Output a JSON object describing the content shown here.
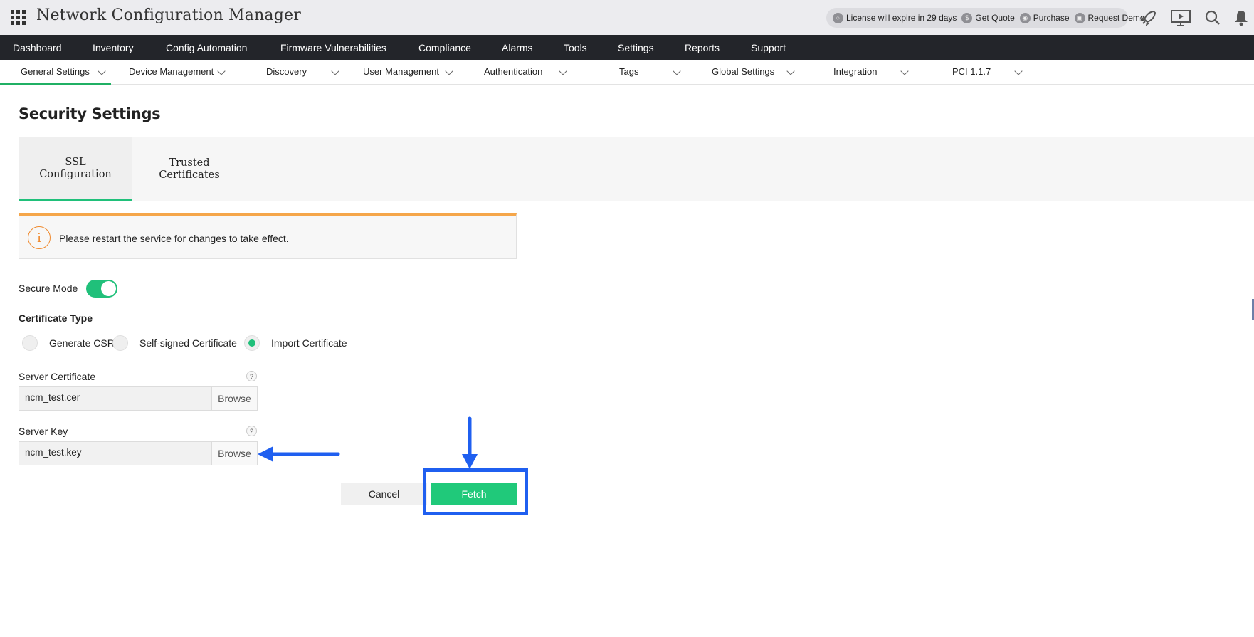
{
  "app": {
    "title": "Network Configuration Manager",
    "license_text": "License will expire in 29 days",
    "get_quote": "Get Quote",
    "purchase": "Purchase",
    "request_demo": "Request Demo"
  },
  "main_nav": [
    "Dashboard",
    "Inventory",
    "Config Automation",
    "Firmware Vulnerabilities",
    "Compliance",
    "Alarms",
    "Tools",
    "Settings",
    "Reports",
    "Support"
  ],
  "sub_nav": [
    "General Settings",
    "Device Management",
    "Discovery",
    "User Management",
    "Authentication",
    "Tags",
    "Global Settings",
    "Integration",
    "PCI 1.1.7"
  ],
  "page": {
    "title": "Security Settings",
    "tabs": [
      {
        "line1": "SSL",
        "line2": "Configuration",
        "active": true
      },
      {
        "line1": "Trusted",
        "line2": "Certificates",
        "active": false
      }
    ],
    "alert": "Please restart the service for changes to take effect.",
    "secure_mode_label": "Secure Mode",
    "secure_mode_on": true,
    "certificate_type_label": "Certificate Type",
    "certificate_options": [
      "Generate CSR",
      "Self-signed Certificate",
      "Import Certificate"
    ],
    "certificate_selected": "Import Certificate",
    "server_certificate_label": "Server Certificate",
    "server_certificate_value": "ncm_test.cer",
    "server_key_label": "Server Key",
    "server_key_value": "ncm_test.key",
    "browse_label": "Browse",
    "help_mark": "?",
    "cancel_label": "Cancel",
    "fetch_label": "Fetch"
  },
  "colors": {
    "accent_green": "#20c97a",
    "annotation_blue": "#1f5ff0",
    "alert_orange": "#f5a64a",
    "nav_bg": "#23252a"
  }
}
